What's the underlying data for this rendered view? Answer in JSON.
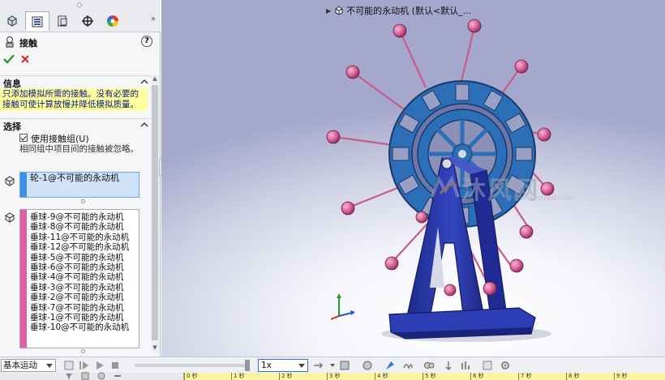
{
  "property_manager": {
    "title": "接触",
    "info_section": {
      "title": "信息",
      "text": "只添加模拟所需的接触。没有必要的接触可使计算放慢并降低模拟质量。"
    },
    "selection_section": {
      "title": "选择",
      "use_contact_groups_label": "使用接触组(U)",
      "use_contact_groups_checked": true,
      "hint": "相同组中项目间的接触被忽略。",
      "group1": [
        "轮-1@不可能的永动机"
      ],
      "group2": [
        "垂球-9@不可能的永动机",
        "垂球-8@不可能的永动机",
        "垂球-11@不可能的永动机",
        "垂球-12@不可能的永动机",
        "垂球-5@不可能的永动机",
        "垂球-6@不可能的永动机",
        "垂球-4@不可能的永动机",
        "垂球-3@不可能的永动机",
        "垂球-2@不可能的永动机",
        "垂球-7@不可能的永动机",
        "垂球-1@不可能的永动机",
        "垂球-10@不可能的永动机"
      ]
    }
  },
  "graphics": {
    "tree_flyout": "不可能的永动机 (默认<默认_...",
    "watermark": "沐风网",
    "watermark_url": "www.mfcad.com"
  },
  "motion_manager": {
    "study_type": "基本运动",
    "playback_speed": "1x",
    "timeline_ticks": [
      "0 秒",
      "1 秒",
      "2 秒",
      "3 秒",
      "4 秒",
      "5 秒",
      "6 秒",
      "7 秒",
      "8 秒",
      "9 秒",
      "10 秒"
    ]
  },
  "colors": {
    "wheel": "#2c6fb8",
    "frame": "#2b3aa8",
    "balls": "#d8649a",
    "group1_marker": "#3d8ee6",
    "group2_marker": "#e25fa8",
    "info_background": "#ffff9e"
  },
  "icons": {
    "ok": "checkmark-icon",
    "cancel": "x-icon",
    "help": "help-icon"
  }
}
